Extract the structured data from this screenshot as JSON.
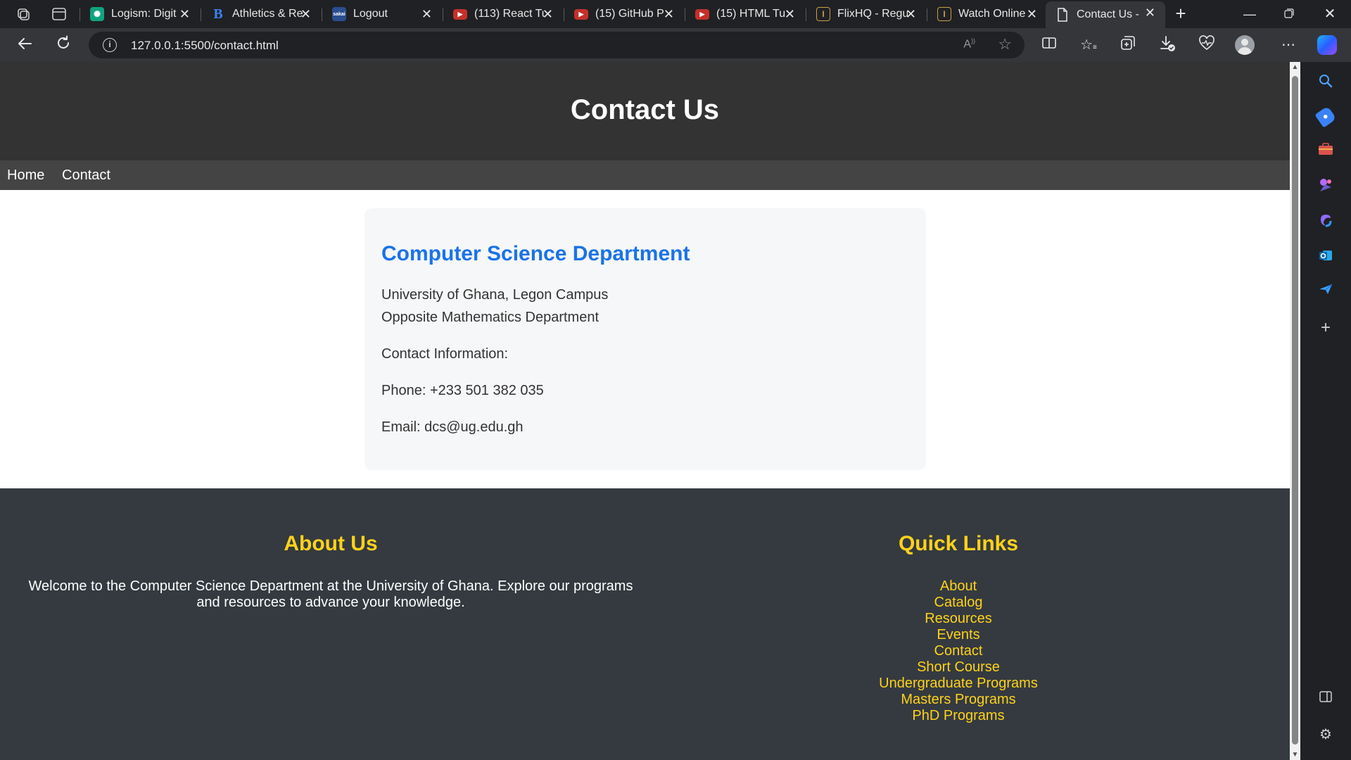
{
  "browser": {
    "tabs": [
      {
        "label": "Logism: Digit",
        "icon": "chatgpt-icon",
        "color": "#10a37f"
      },
      {
        "label": "Athletics & Re",
        "icon": "bing-b-icon",
        "color": "#3b82f6"
      },
      {
        "label": "Logout",
        "icon": "sakai-icon",
        "color": "#2a4d8f"
      },
      {
        "label": "(113) React Tu",
        "icon": "youtube-icon",
        "color": "#ff0000"
      },
      {
        "label": "(15) GitHub P",
        "icon": "youtube-icon",
        "color": "#ff0000"
      },
      {
        "label": "(15) HTML Tu",
        "icon": "youtube-icon",
        "color": "#ff0000"
      },
      {
        "label": "FlixHQ - Regu",
        "icon": "flixhq-icon",
        "color": "#c8a04a"
      },
      {
        "label": "Watch Online",
        "icon": "flixhq-icon",
        "color": "#c8a04a"
      },
      {
        "label": "Contact Us - ",
        "icon": "page-icon",
        "color": "#e8e8e8"
      }
    ],
    "url": "127.0.0.1:5500/contact.html"
  },
  "header": {
    "title": "Contact Us"
  },
  "nav": {
    "home": "Home",
    "contact": "Contact"
  },
  "contact_card": {
    "title": "Computer Science Department",
    "address_line1": "University of Ghana, Legon Campus",
    "address_line2": "Opposite Mathematics Department",
    "info_heading": "Contact Information:",
    "phone": "Phone: +233 501 382 035",
    "email": "Email: dcs@ug.edu.gh"
  },
  "footer": {
    "about_title": "About Us",
    "about_text": "Welcome to the Computer Science Department at the University of Ghana. Explore our programs and resources to advance your knowledge.",
    "links_title": "Quick Links",
    "links": [
      "About",
      "Catalog",
      "Resources",
      "Events",
      "Contact",
      "Short Course",
      "Undergraduate Programs",
      "Masters Programs",
      "PhD Programs"
    ]
  },
  "colors": {
    "header_bg": "#333333",
    "nav_bg": "#444444",
    "card_title": "#1a73e8",
    "footer_bg": "#343a40",
    "footer_accent": "#ffd21a"
  }
}
